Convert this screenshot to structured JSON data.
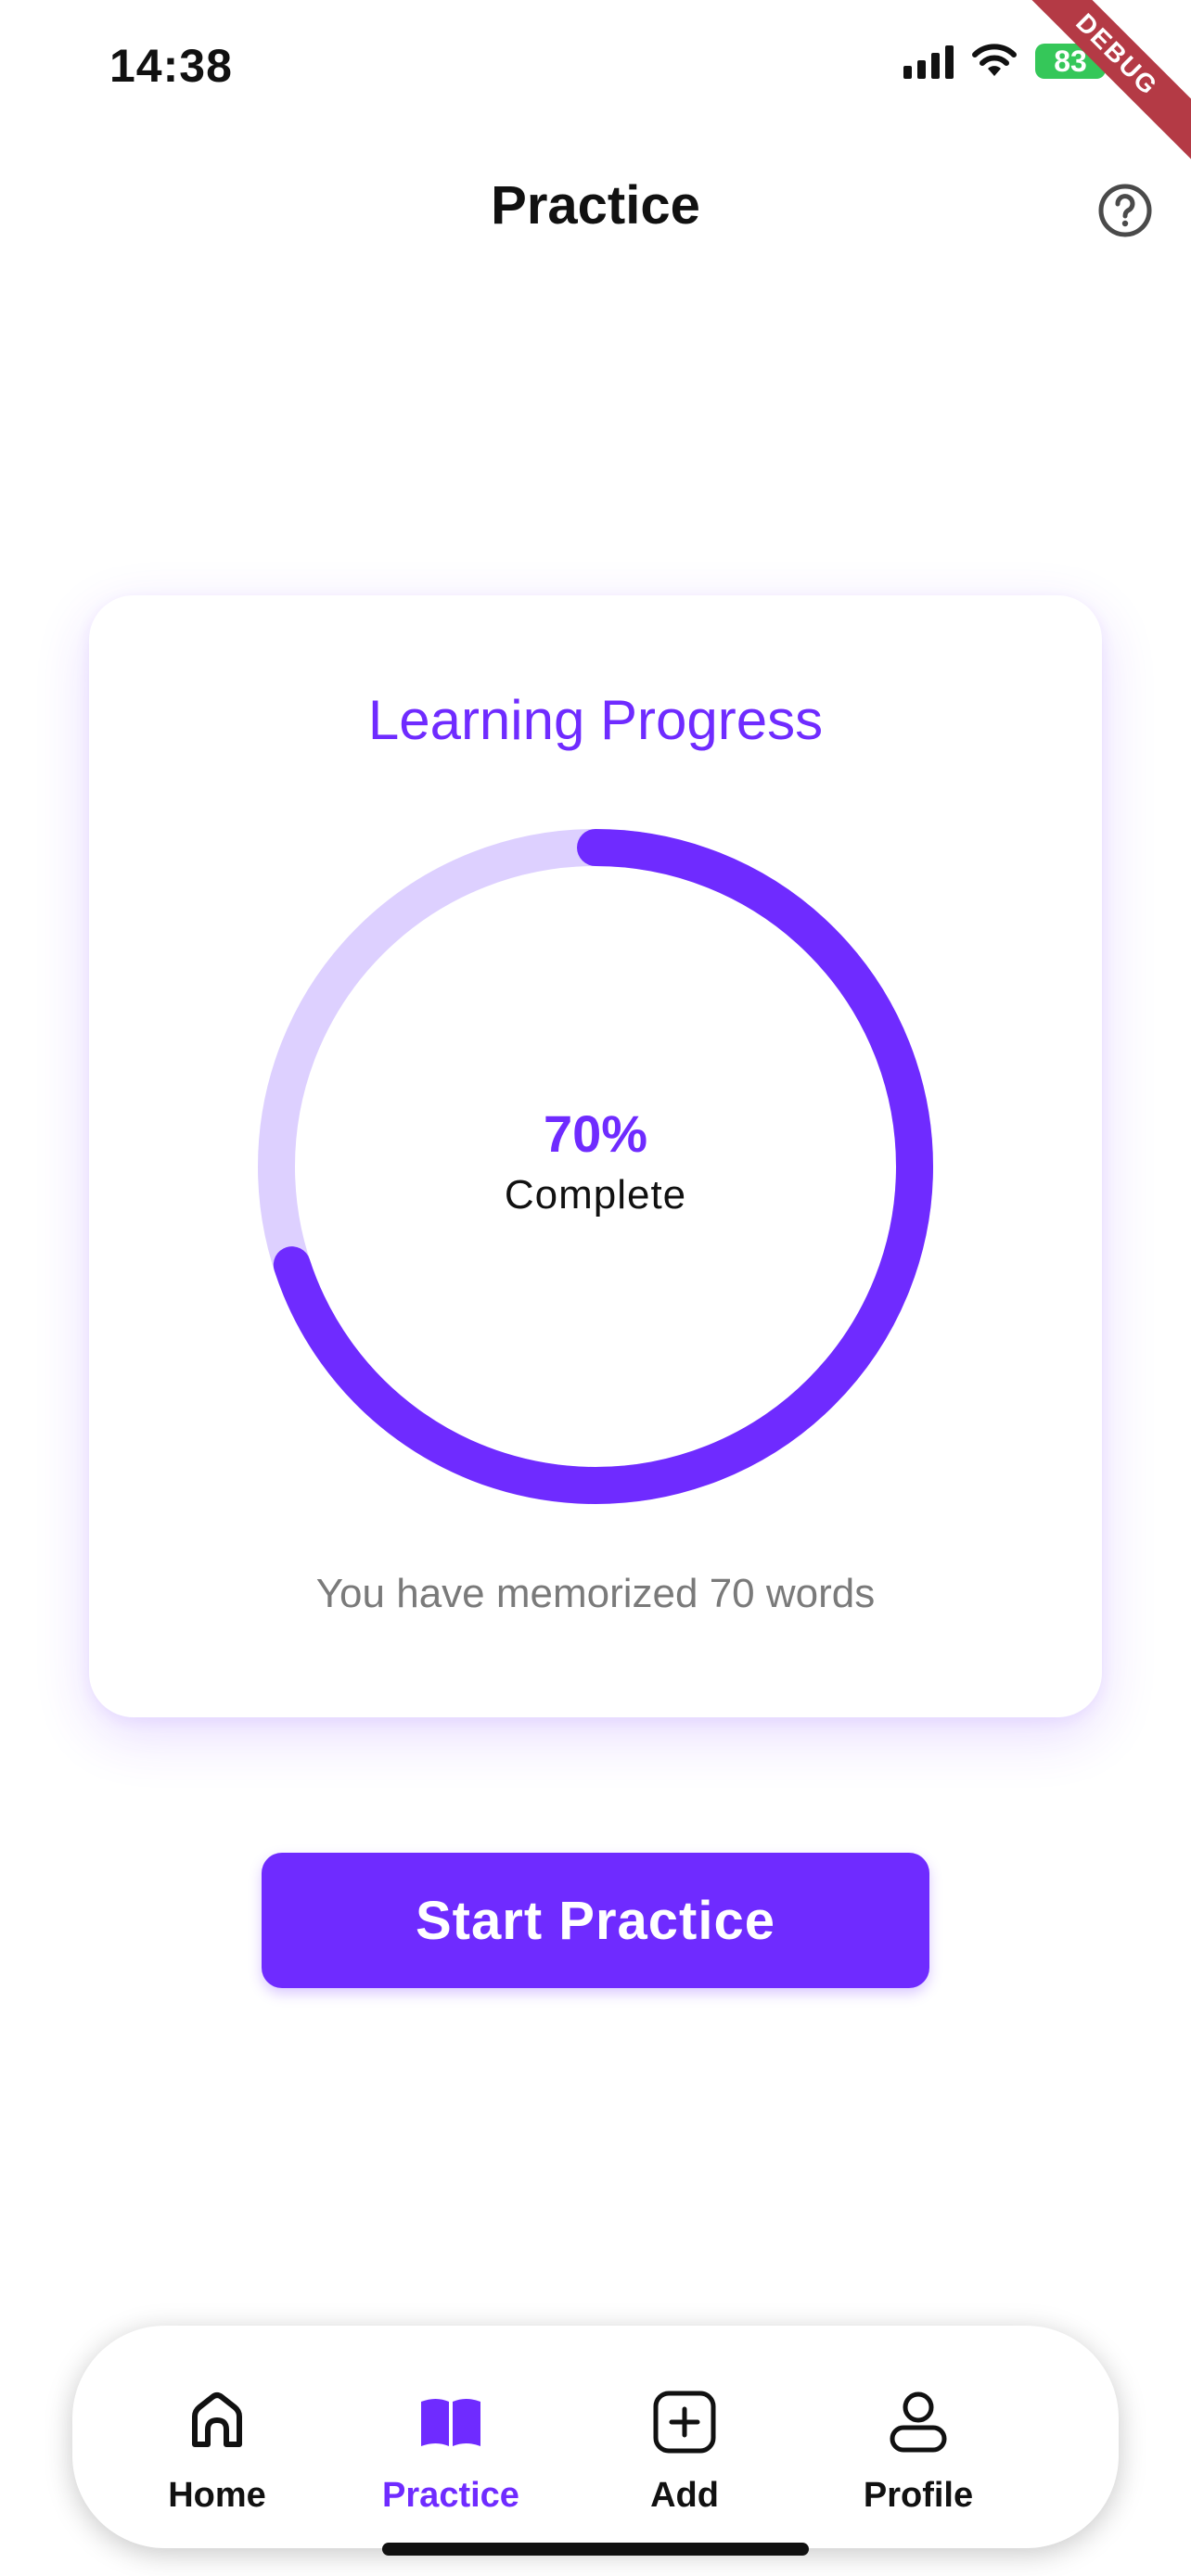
{
  "status_bar": {
    "time": "14:38",
    "battery": "83",
    "debug_label": "DEBUG"
  },
  "app_bar": {
    "title": "Practice",
    "help_icon": "help-circle-icon"
  },
  "card": {
    "title": "Learning Progress",
    "progress_fraction": 0.7,
    "percent_label": "70%",
    "complete_label": "Complete",
    "memorized_text": "You have memorized 70 words"
  },
  "actions": {
    "start_label": "Start Practice"
  },
  "bottom_nav": {
    "items": [
      {
        "label": "Home",
        "icon": "home-icon",
        "active": false
      },
      {
        "label": "Practice",
        "icon": "book-icon",
        "active": true
      },
      {
        "label": "Add",
        "icon": "add-square-icon",
        "active": false
      },
      {
        "label": "Profile",
        "icon": "profile-icon",
        "active": false
      }
    ]
  },
  "colors": {
    "accent": "#6f2bff",
    "track": "#ddd0ff",
    "battery": "#35c759",
    "debug": "#b43a45"
  }
}
